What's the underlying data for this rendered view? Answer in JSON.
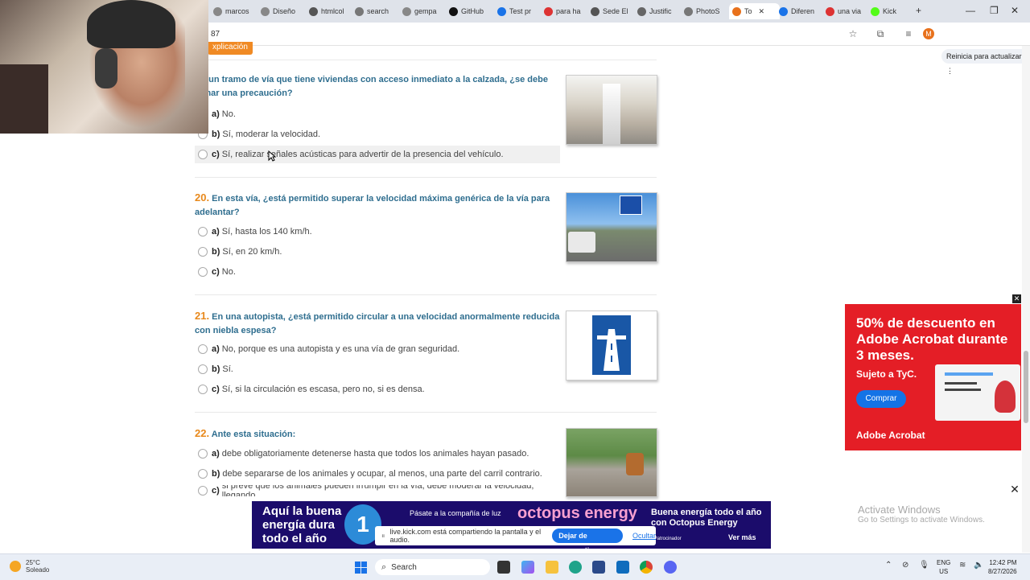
{
  "browser": {
    "tabs": [
      {
        "label": "marcos",
        "color": "#888"
      },
      {
        "label": "Diseño",
        "color": "#888"
      },
      {
        "label": "htmlcol",
        "color": "#555"
      },
      {
        "label": "search",
        "color": "#777"
      },
      {
        "label": "gempa",
        "color": "#888"
      },
      {
        "label": "GitHub",
        "color": "#111"
      },
      {
        "label": "Test pr",
        "color": "#1a73e8"
      },
      {
        "label": "para ha",
        "color": "#d33"
      },
      {
        "label": "Sede El",
        "color": "#555"
      },
      {
        "label": "Justific",
        "color": "#666"
      },
      {
        "label": "PhotoS",
        "color": "#777"
      },
      {
        "label": "To",
        "color": "#e8711c"
      },
      {
        "label": "Diferen",
        "color": "#1a73e8"
      },
      {
        "label": "una via",
        "color": "#d33"
      },
      {
        "label": "Kick",
        "color": "#53fc18"
      }
    ],
    "new_tab": "+",
    "url": "87",
    "avatar_letter": "M",
    "update_label": "Reinicia para actualizar"
  },
  "page": {
    "explicacion_label": "xplicación",
    "questions": [
      {
        "number": "",
        "title": "En un tramo de vía que tiene viviendas con acceso inmediato a la calzada, ¿se debe tomar una precaución?",
        "options": [
          {
            "letter": "a)",
            "text": "No."
          },
          {
            "letter": "b)",
            "text": "Sí, moderar la velocidad."
          },
          {
            "letter": "c)",
            "text": "Sí, realizar señales acústicas para advertir de la presencia del vehículo."
          }
        ]
      },
      {
        "number": "20.",
        "title": "En esta vía, ¿está permitido superar la velocidad máxima genérica de la vía para adelantar?",
        "options": [
          {
            "letter": "a)",
            "text": "Sí, hasta los 140 km/h."
          },
          {
            "letter": "b)",
            "text": "Sí, en 20 km/h."
          },
          {
            "letter": "c)",
            "text": "No."
          }
        ]
      },
      {
        "number": "21.",
        "title": "En una autopista, ¿está permitido circular a una velocidad anormalmente reducida con niebla espesa?",
        "options": [
          {
            "letter": "a)",
            "text": "No, porque es una autopista y es una vía de gran seguridad."
          },
          {
            "letter": "b)",
            "text": "Sí."
          },
          {
            "letter": "c)",
            "text": "Sí, si la circulación es escasa, pero no, si es densa."
          }
        ]
      },
      {
        "number": "22.",
        "title": "Ante esta situación:",
        "options": [
          {
            "letter": "a)",
            "text": "debe obligatoriamente detenerse hasta que todos los animales hayan pasado."
          },
          {
            "letter": "b)",
            "text": "debe separarse de los animales y ocupar, al menos, una parte del carril contrario."
          },
          {
            "letter": "c)",
            "text": "si prevé que los animales pueden irrumpir en la vía, debe moderar la velocidad, llegando"
          }
        ]
      }
    ]
  },
  "ads": {
    "adobe": {
      "headline": "50% de descuento en Adobe Acrobat durante 3 meses.",
      "subtitle": "Sujeto a TyC.",
      "button": "Comprar",
      "brand": "Adobe Acrobat",
      "color": "#e41e26"
    },
    "octopus": {
      "left": "Aquí la buena energía dura todo el año",
      "badge": "1",
      "middle": "Pásate a la compañía de luz",
      "brand": "octopus energy",
      "right": "Buena energía todo el año con Octopus Energy",
      "more": "Ver más",
      "sponsored": "cio por Patrocinador"
    },
    "close": "✕"
  },
  "share_bar": {
    "text": "live.kick.com está compartiendo la pantalla y el audio.",
    "stop": "Dejar de compartir",
    "hide": "Ocultar"
  },
  "watermark": {
    "title": "Activate Windows",
    "subtitle": "Go to Settings to activate Windows."
  },
  "taskbar": {
    "weather_temp": "25°C",
    "weather_desc": "Soleado",
    "search_placeholder": "Search",
    "lang1": "ENG",
    "lang2": "US",
    "time": "12:42 PM",
    "date": "8/27/2026"
  }
}
